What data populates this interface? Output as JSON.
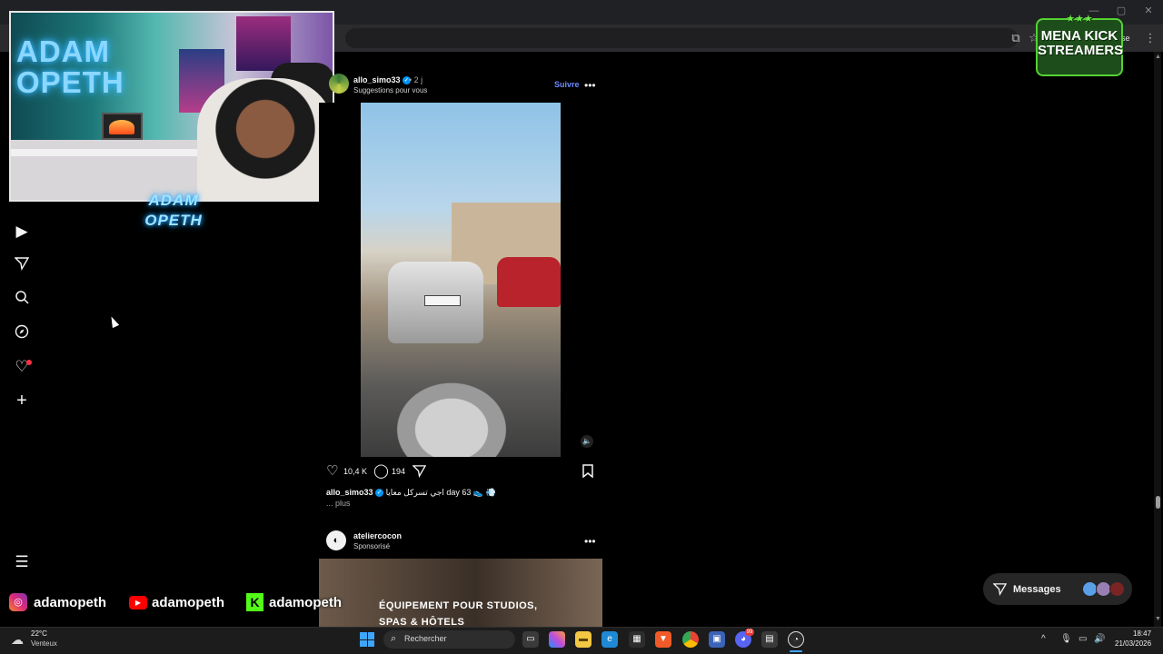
{
  "browser": {
    "icons": [
      "install-icon",
      "bookmark-star-icon",
      "menu-dots-icon"
    ],
    "partial_text": "se"
  },
  "overlay": {
    "webcam_text": "ADAM\nOPETH",
    "webcam_logo": "ADAM OPETH",
    "mena_kick": {
      "line1": "MENA KICK",
      "line2": "STREAMERS",
      "stars": "★★★"
    }
  },
  "sidebar": {
    "items": [
      {
        "name": "reels",
        "icon": "reels-icon"
      },
      {
        "name": "messages",
        "icon": "paper-plane-icon"
      },
      {
        "name": "search",
        "icon": "search-icon"
      },
      {
        "name": "explore",
        "icon": "compass-icon"
      },
      {
        "name": "notifications",
        "icon": "heart-icon"
      },
      {
        "name": "create",
        "icon": "plus-icon"
      },
      {
        "name": "more",
        "icon": "hamburger-icon"
      }
    ]
  },
  "post1": {
    "username": "allo_simo33",
    "time": "• 2 j",
    "subtitle": "Suggestions pour vous",
    "follow_label": "Suivre",
    "more_label": "•••",
    "likes": "10,4 K",
    "comments": "194",
    "caption_user": "allo_simo33",
    "caption_text": "اجي تسركل معايا day 63 👟 💨",
    "more_link": "... plus"
  },
  "post2": {
    "username": "ateliercocon",
    "subtitle": "Sponsorisé",
    "more_label": "•••",
    "ad_line1": "ÉQUIPEMENT POUR STUDIOS,",
    "ad_line2": "SPAS & HÔTELS"
  },
  "messages": {
    "label": "Messages"
  },
  "social": {
    "instagram": "adamopeth",
    "youtube": "adamopeth",
    "kick": "adamopeth"
  },
  "taskbar": {
    "weather_temp": "22°C",
    "weather_desc": "Venteux",
    "search_placeholder": "Rechercher",
    "discord_badge": "99",
    "time": "18:47",
    "date": "21/03/2026"
  }
}
